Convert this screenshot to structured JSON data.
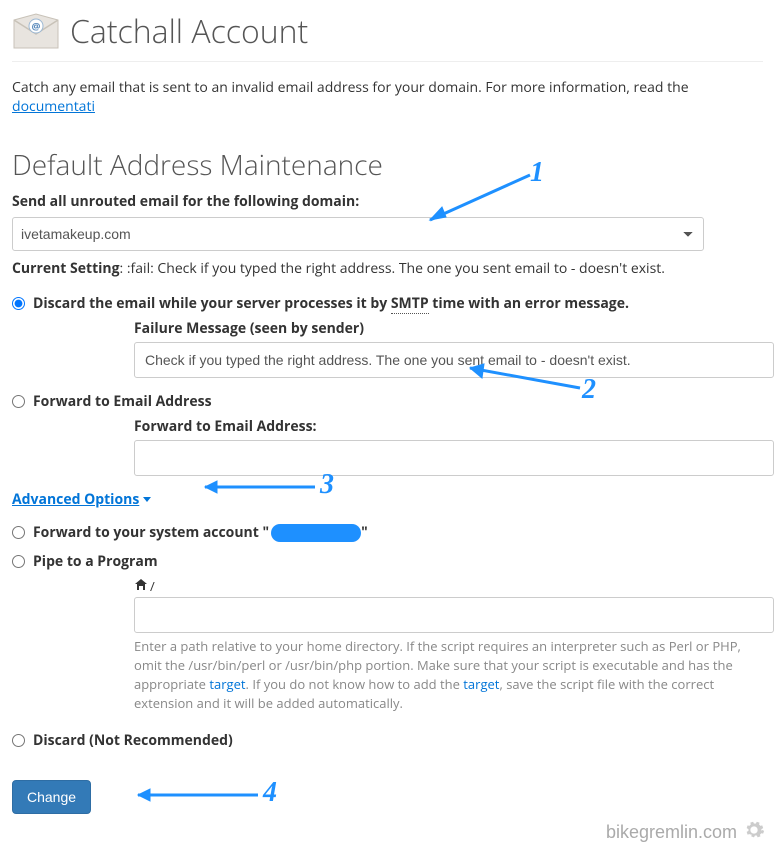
{
  "header": {
    "title": "Catchall Account"
  },
  "intro": {
    "text": "Catch any email that is sent to an invalid email address for your domain. For more information, read the ",
    "link": "documentati"
  },
  "section_title": "Default Address Maintenance",
  "domain": {
    "label": "Send all unrouted email for the following domain:",
    "value": "ivetamakeup.com"
  },
  "current_setting": {
    "label": "Current Setting",
    "value": ": :fail: Check if you typed the right address. The one you sent email to - doesn't exist."
  },
  "options": {
    "discard_smtp": {
      "label_pre": "Discard the email while your server processes it by ",
      "smtp": "SMTP",
      "label_post": " time with an error message.",
      "failure_label": "Failure Message (seen by sender)",
      "failure_value": "Check if you typed the right address. The one you sent email to - doesn't exist."
    },
    "forward_email": {
      "label": "Forward to Email Address",
      "field_label": "Forward to Email Address:",
      "value": ""
    },
    "advanced_label": "Advanced Options ",
    "forward_system": {
      "label_pre": "Forward to your system account \"",
      "label_post": "\""
    },
    "pipe": {
      "label": "Pipe to a Program",
      "path_prefix": "/",
      "value": "",
      "help_1": "Enter a path relative to your home directory. If the script requires an interpreter such as Perl or PHP, omit the /usr/bin/perl or /usr/bin/php portion. Make sure that your script is executable and has the appropriate ",
      "help_link1": "target",
      "help_2": ". If you do not know how to add the ",
      "help_link2": "target",
      "help_3": ", save the script file with the correct extension and it will be added automatically."
    },
    "discard_not_recommended": {
      "label": "Discard (Not Recommended)"
    }
  },
  "submit_label": "Change",
  "watermark": "bikegremlin.com",
  "annotations": {
    "n1": "1",
    "n2": "2",
    "n3": "3",
    "n4": "4"
  }
}
